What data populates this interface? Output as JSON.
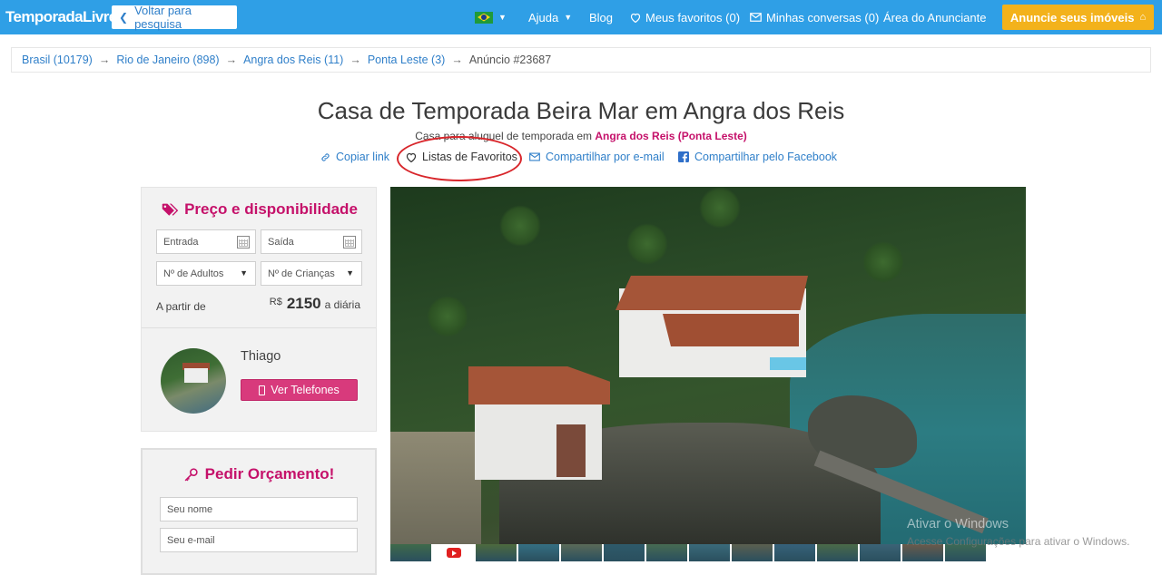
{
  "header": {
    "logo_text": "TemporadaLivre",
    "logo_tm": "™",
    "back_label": "Voltar para pesquisa",
    "nav": {
      "help": "Ajuda",
      "blog": "Blog",
      "favorites": "Meus favoritos (0)",
      "conversations": "Minhas conversas (0)",
      "advertiser": "Área do Anunciante"
    },
    "cta_label": "Anuncie seus imóveis",
    "accent_color": "#2f9fe6",
    "cta_color": "#f3b21b"
  },
  "breadcrumb": {
    "items": [
      {
        "label": "Brasil (10179)"
      },
      {
        "label": "Rio de Janeiro (898)"
      },
      {
        "label": "Angra dos Reis (11)"
      },
      {
        "label": "Ponta Leste (3)"
      }
    ],
    "separator": "→",
    "current": "Anúncio #23687"
  },
  "listing": {
    "title": "Casa de Temporada Beira Mar em Angra dos Reis",
    "subtitle_prefix": "Casa para aluguel de temporada em",
    "subtitle_location": "Angra dos Reis (Ponta Leste)",
    "actions": {
      "copy_link": "Copiar link",
      "favorites_list": "Listas de Favoritos",
      "share_email": "Compartilhar por e-mail",
      "share_facebook": "Compartilhar pelo Facebook"
    }
  },
  "booking": {
    "title": "Preço e disponibilidade",
    "checkin_placeholder": "Entrada",
    "checkout_placeholder": "Saída",
    "adults_placeholder": "Nº de Adultos",
    "children_placeholder": "Nº de Crianças",
    "from_label": "A partir de",
    "currency": "R$",
    "price": "2150",
    "price_unit": "a diária",
    "brand_color": "#c5116a"
  },
  "host": {
    "name": "Thiago",
    "phones_button": "Ver Telefones"
  },
  "quote": {
    "title": "Pedir Orçamento!",
    "name_placeholder": "Seu nome",
    "email_placeholder": "Seu e-mail"
  },
  "gallery": {
    "thumbnail_count": 14,
    "video_icon": "youtube-icon"
  },
  "os_watermark": {
    "line1": "Ativar o Windows",
    "line2": "Acesse Configurações para ativar o Windows."
  }
}
